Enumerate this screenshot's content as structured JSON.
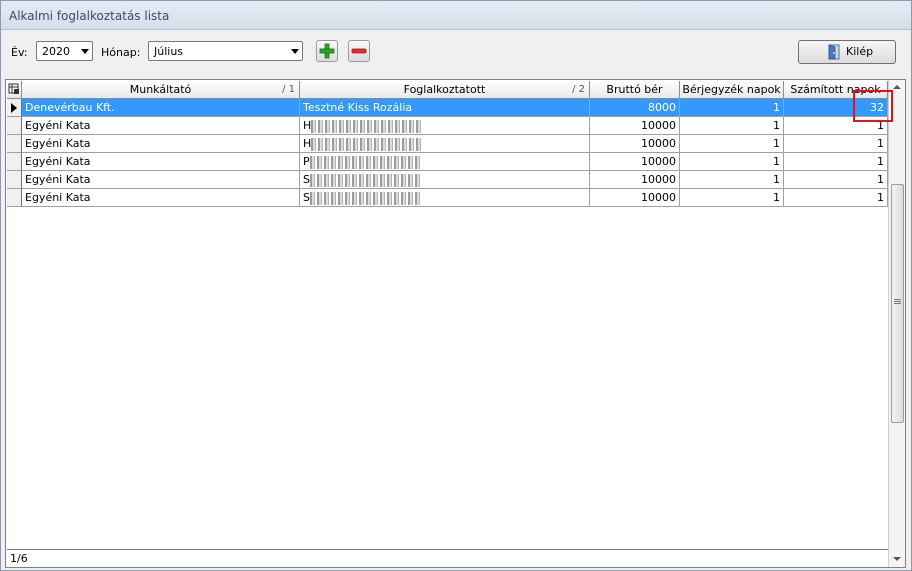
{
  "window": {
    "title": "Alkalmi foglalkoztatás lista"
  },
  "toolbar": {
    "year_label": "Év:",
    "year_value": "2020",
    "month_label": "Hónap:",
    "month_value": "Július",
    "add_icon": "plus-icon",
    "remove_icon": "minus-icon",
    "exit_label": "Kilép",
    "exit_icon": "door-icon"
  },
  "grid": {
    "columns": [
      {
        "label": "Munkáltató",
        "sort": "/ 1"
      },
      {
        "label": "Foglalkoztatott",
        "sort": "/ 2"
      },
      {
        "label": "Bruttó bér",
        "sort": ""
      },
      {
        "label": "Bérjegyzék napok",
        "sort": ""
      },
      {
        "label": "Számított napok",
        "sort": ""
      }
    ],
    "rows": [
      {
        "employer": "Denevérbau Kft.",
        "employee": "Tesztné Kiss Rozália",
        "gross": "8000",
        "payroll_days": "1",
        "calc_days": "32",
        "selected": true
      },
      {
        "employer": "Egyéni Kata",
        "employee": "H",
        "gross": "10000",
        "payroll_days": "1",
        "calc_days": "1",
        "selected": false
      },
      {
        "employer": "Egyéni Kata",
        "employee": "H",
        "gross": "10000",
        "payroll_days": "1",
        "calc_days": "1",
        "selected": false
      },
      {
        "employer": "Egyéni Kata",
        "employee": "P",
        "gross": "10000",
        "payroll_days": "1",
        "calc_days": "1",
        "selected": false
      },
      {
        "employer": "Egyéni Kata",
        "employee": "S",
        "gross": "10000",
        "payroll_days": "1",
        "calc_days": "1",
        "selected": false
      },
      {
        "employer": "Egyéni Kata",
        "employee": "S",
        "gross": "10000",
        "payroll_days": "1",
        "calc_days": "1",
        "selected": false
      }
    ],
    "status": "1/6"
  },
  "colors": {
    "selection": "#3399ff",
    "highlight_box": "#e0161b"
  }
}
